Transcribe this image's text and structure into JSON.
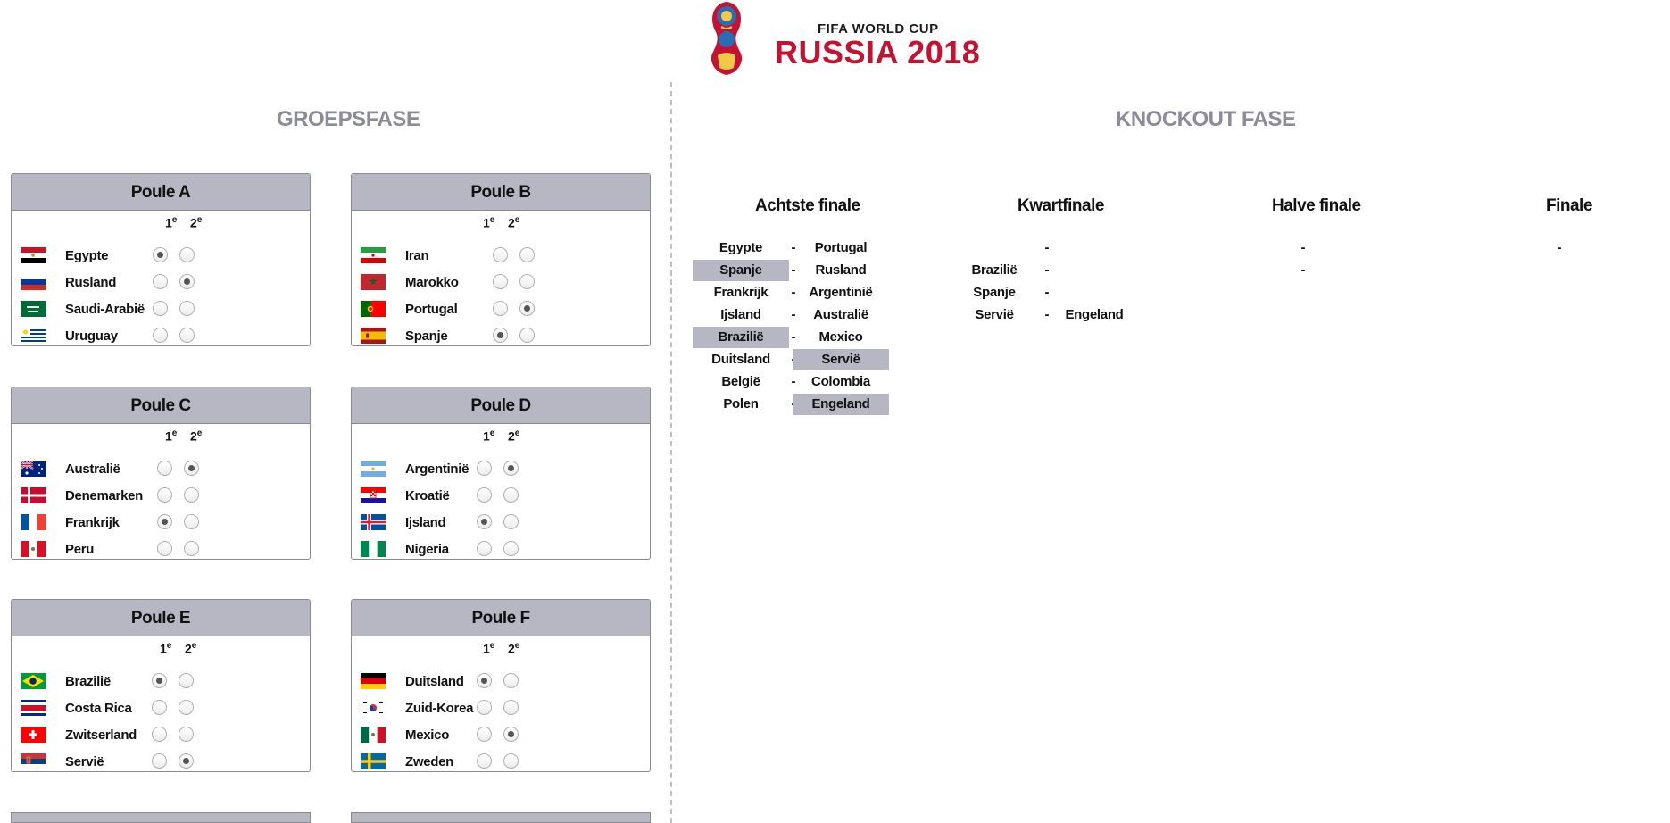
{
  "header": {
    "logo_line1": "FIFA WORLD CUP",
    "logo_line2": "RUSSIA 2018",
    "logo_icon": "world-cup-trophy-emblem",
    "brand_red": "#c41230"
  },
  "groepsfase": {
    "title": "GROEPSFASE",
    "col_first_num": "1",
    "col_first_sup": "e",
    "col_second_num": "2",
    "col_second_sup": "e",
    "poules": [
      {
        "name": "Poule A",
        "teams": [
          {
            "name": "Egypte",
            "flag": "egypt-flag",
            "first": true,
            "second": false
          },
          {
            "name": "Rusland",
            "flag": "russia-flag",
            "first": false,
            "second": true
          },
          {
            "name": "Saudi-Arabië",
            "flag": "saudi-arabia-flag",
            "first": false,
            "second": false
          },
          {
            "name": "Uruguay",
            "flag": "uruguay-flag",
            "first": false,
            "second": false
          }
        ]
      },
      {
        "name": "Poule B",
        "teams": [
          {
            "name": "Iran",
            "flag": "iran-flag",
            "first": false,
            "second": false
          },
          {
            "name": "Marokko",
            "flag": "morocco-flag",
            "first": false,
            "second": false
          },
          {
            "name": "Portugal",
            "flag": "portugal-flag",
            "first": false,
            "second": true
          },
          {
            "name": "Spanje",
            "flag": "spain-flag",
            "first": true,
            "second": false
          }
        ]
      },
      {
        "name": "Poule C",
        "teams": [
          {
            "name": "Australië",
            "flag": "australia-flag",
            "first": false,
            "second": true
          },
          {
            "name": "Denemarken",
            "flag": "denmark-flag",
            "first": false,
            "second": false
          },
          {
            "name": "Frankrijk",
            "flag": "france-flag",
            "first": true,
            "second": false
          },
          {
            "name": "Peru",
            "flag": "peru-flag",
            "first": false,
            "second": false
          }
        ]
      },
      {
        "name": "Poule D",
        "teams": [
          {
            "name": "Argentinië",
            "flag": "argentina-flag",
            "first": false,
            "second": true
          },
          {
            "name": "Kroatië",
            "flag": "croatia-flag",
            "first": false,
            "second": false
          },
          {
            "name": "Ijsland",
            "flag": "iceland-flag",
            "first": true,
            "second": false
          },
          {
            "name": "Nigeria",
            "flag": "nigeria-flag",
            "first": false,
            "second": false
          }
        ]
      },
      {
        "name": "Poule E",
        "teams": [
          {
            "name": "Brazilië",
            "flag": "brazil-flag",
            "first": true,
            "second": false
          },
          {
            "name": "Costa Rica",
            "flag": "costa-rica-flag",
            "first": false,
            "second": false
          },
          {
            "name": "Zwitserland",
            "flag": "switzerland-flag",
            "first": false,
            "second": false
          },
          {
            "name": "Servië",
            "flag": "serbia-flag",
            "first": false,
            "second": true
          }
        ]
      },
      {
        "name": "Poule F",
        "teams": [
          {
            "name": "Duitsland",
            "flag": "germany-flag",
            "first": true,
            "second": false
          },
          {
            "name": "Zuid-Korea",
            "flag": "south-korea-flag",
            "first": false,
            "second": false
          },
          {
            "name": "Mexico",
            "flag": "mexico-flag",
            "first": false,
            "second": true
          },
          {
            "name": "Zweden",
            "flag": "sweden-flag",
            "first": false,
            "second": false
          }
        ]
      }
    ]
  },
  "knockout": {
    "title": "KNOCKOUT FASE",
    "rounds": [
      "Achtste finale",
      "Kwartfinale",
      "Halve finale",
      "Finale"
    ],
    "dash": "-",
    "achtste": [
      {
        "home": "Egypte",
        "away": "Portugal",
        "winner": ""
      },
      {
        "home": "Spanje",
        "away": "Rusland",
        "winner": "home"
      },
      {
        "home": "Frankrijk",
        "away": "Argentinië",
        "winner": ""
      },
      {
        "home": "Ijsland",
        "away": "Australië",
        "winner": ""
      },
      {
        "home": "Brazilië",
        "away": "Mexico",
        "winner": "home"
      },
      {
        "home": "Duitsland",
        "away": "Servië",
        "winner": "away"
      },
      {
        "home": "België",
        "away": "Colombia",
        "winner": ""
      },
      {
        "home": "Polen",
        "away": "Engeland",
        "winner": "away"
      }
    ],
    "kwart": [
      {
        "home": "",
        "away": ""
      },
      {
        "home": "Brazilië",
        "away": ""
      },
      {
        "home": "Spanje",
        "away": ""
      },
      {
        "home": "Servië",
        "away": "Engeland"
      }
    ],
    "halve": [
      {
        "home": "",
        "away": ""
      },
      {
        "home": "",
        "away": ""
      }
    ],
    "finale": [
      {
        "home": "",
        "away": ""
      }
    ],
    "highlight_color": "#b7b7c4"
  }
}
